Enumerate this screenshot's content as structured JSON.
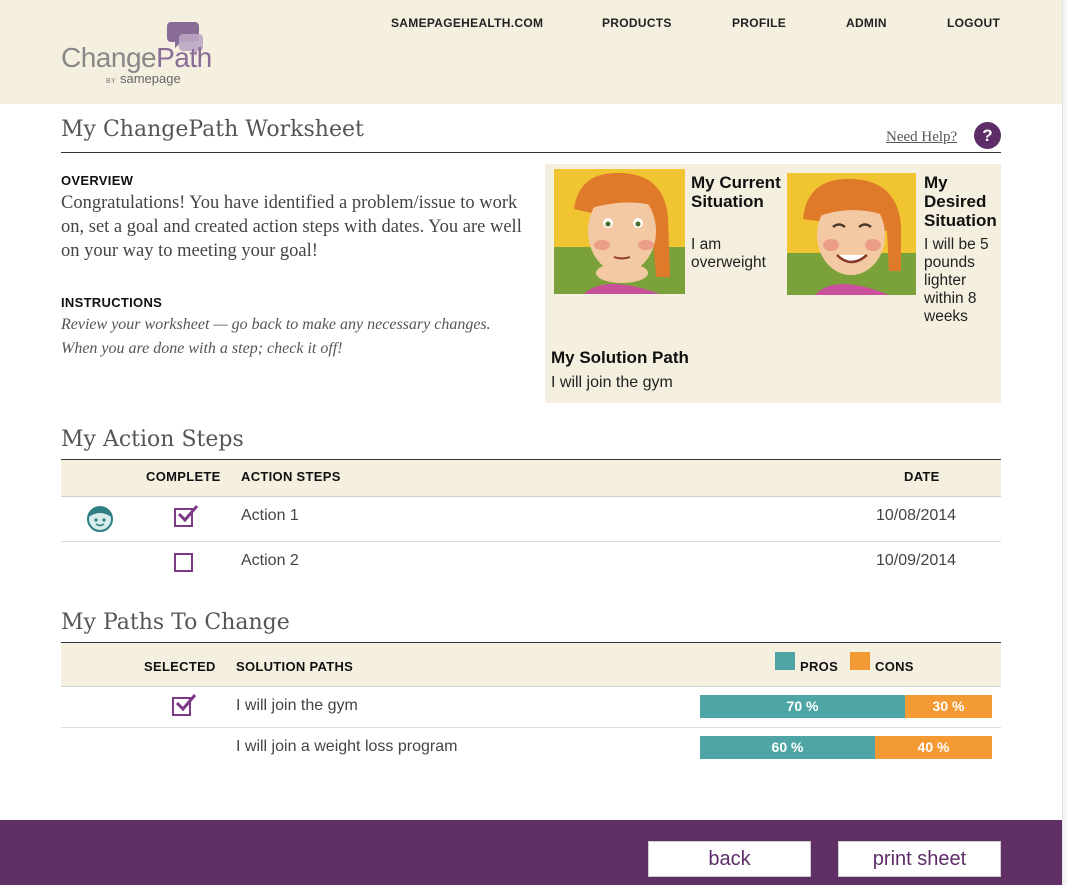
{
  "brand": {
    "name_part1": "Change",
    "name_part2": "Path",
    "by_label": "BY",
    "by_name": "samepage"
  },
  "nav": {
    "items": [
      "SAMEPAGEHEALTH.COM",
      "PRODUCTS",
      "PROFILE",
      "ADMIN",
      "LOGOUT"
    ]
  },
  "page": {
    "title": "My ChangePath Worksheet",
    "help_label": "Need Help?",
    "help_icon_glyph": "?"
  },
  "overview": {
    "label": "OVERVIEW",
    "text": "Congratulations! You have identified a problem/issue to work on, set a goal and created action steps with dates. You are well on your way to meeting your goal!"
  },
  "instructions": {
    "label": "INSTRUCTIONS",
    "text": "Review your worksheet — go back to make any necessary changes. When you are done with a step; check it off!"
  },
  "situation": {
    "current_title": "My Current Situation",
    "current_text": "I am overweight",
    "desired_title": "My Desired Situation",
    "desired_text": "I will be 5 pounds lighter within 8 weeks",
    "solution_title": "My Solution Path",
    "solution_text": "I will join the gym"
  },
  "action_steps": {
    "title": "My Action Steps",
    "headers": {
      "complete": "COMPLETE",
      "steps": "ACTION STEPS",
      "date": "DATE"
    },
    "rows": [
      {
        "label": "Action 1",
        "date": "10/08/2014",
        "complete": true,
        "icon": "face-icon"
      },
      {
        "label": "Action 2",
        "date": "10/09/2014",
        "complete": false
      }
    ]
  },
  "paths": {
    "title": "My Paths To Change",
    "headers": {
      "selected": "SELECTED",
      "solution": "SOLUTION PATHS",
      "pros": "PROS",
      "cons": "CONS"
    },
    "rows": [
      {
        "label": "I will join the gym",
        "selected": true,
        "pros": 70,
        "cons": 30,
        "pros_label": "70 %",
        "cons_label": "30 %"
      },
      {
        "label": "I will join a weight loss program",
        "selected": false,
        "pros": 60,
        "cons": 40,
        "pros_label": "60 %",
        "cons_label": "40 %"
      }
    ]
  },
  "footer": {
    "back_label": "back",
    "print_label": "print sheet"
  },
  "colors": {
    "accent": "#5e2d68",
    "header_bg": "#f5efe0",
    "pros": "#4fa5a5",
    "cons": "#f39a35",
    "checkbox": "#7c3a86"
  }
}
